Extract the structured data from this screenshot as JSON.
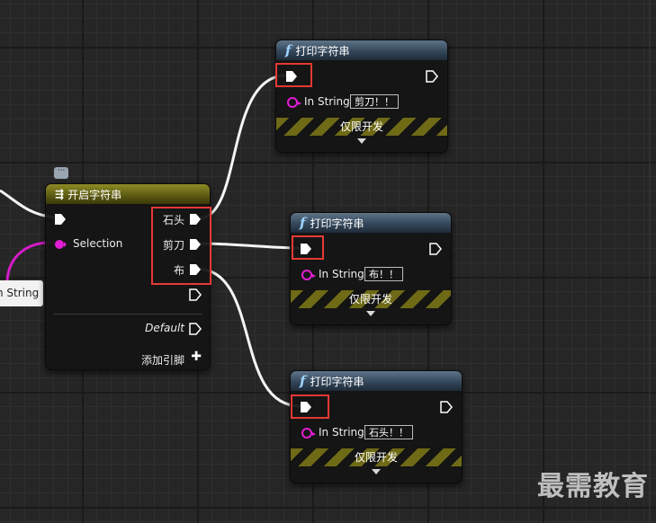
{
  "switch_node": {
    "title": "开启字符串",
    "selection_label": "Selection",
    "outputs": [
      "石头",
      "剪刀",
      "布"
    ],
    "default_label": "Default",
    "add_pin_label": "添加引脚"
  },
  "offscreen_node": {
    "label": "n String"
  },
  "print_nodes": [
    {
      "title": "打印字符串",
      "in_string_label": "In String",
      "in_string_value": "剪刀！！",
      "dev_only_label": "仅限开发"
    },
    {
      "title": "打印字符串",
      "in_string_label": "In String",
      "in_string_value": "布！！",
      "dev_only_label": "仅限开发"
    },
    {
      "title": "打印字符串",
      "in_string_label": "In String",
      "in_string_value": "石头！！",
      "dev_only_label": "仅限开发"
    }
  ],
  "watermark": "最需教育",
  "colors": {
    "exec_wire": "#ffffff",
    "string_pin": "#e31ed4",
    "highlight_box": "#e53935",
    "function_header": "#34475a",
    "switch_header": "#5f5d14"
  }
}
